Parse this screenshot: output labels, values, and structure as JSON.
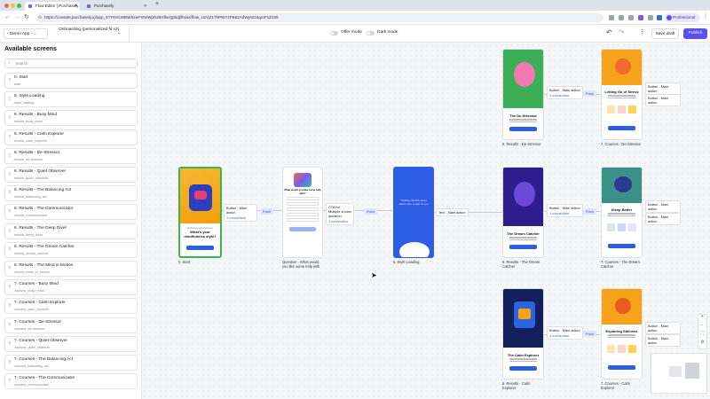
{
  "browser": {
    "tabs": [
      {
        "label": "Flow Editor | Purchasely"
      },
      {
        "label": "Purchasely"
      }
    ],
    "new_tab": "+",
    "url": "https://console.purchasely.io/app_5?YNrGWBWSzeFXNrWpD25rrfbeQpkdj/flows/flow_UoVZ1?hPWYzFB62AdWyW24qmF1Z225",
    "profile_label": "Professional"
  },
  "app": {
    "back_label": "Demo App - ...",
    "flow_name": "Onboarding (personalized fit v2)",
    "offer_mode_label": "Offer mode",
    "dark_mode_label": "Dark mode",
    "save_label": "Save draft",
    "publish_label": "Publish",
    "more_label": "⋮"
  },
  "sidebar": {
    "title": "Available screens",
    "search_placeholder": "Search",
    "items": [
      {
        "name": "0. Start",
        "slug": "start"
      },
      {
        "name": "5. Style Loading",
        "slug": "style_loading"
      },
      {
        "name": "6. Results - Busy Mind",
        "slug": "results_busy_mind"
      },
      {
        "name": "6. Results - Calm Explorer",
        "slug": "results_calm_explorer"
      },
      {
        "name": "6. Results - De-Stressor",
        "slug": "results_de-stressor"
      },
      {
        "name": "6. Results - Quiet Observer",
        "slug": "results_quiet_observer"
      },
      {
        "name": "6. Results - The Balancing Act",
        "slug": "results_balancing_act"
      },
      {
        "name": "6. Results - The Communicator",
        "slug": "results_communicator"
      },
      {
        "name": "6. Results - The Deep Diver",
        "slug": "results_deep_diver"
      },
      {
        "name": "6. Results - The Dream Catcher",
        "slug": "results_dream_catcher"
      },
      {
        "name": "6. Results - The Mind in Motion",
        "slug": "results_mind_in_motion"
      },
      {
        "name": "7. Courses - Busy Mind",
        "slug": "courses_busy_mind"
      },
      {
        "name": "7. Courses - Calm Explorer",
        "slug": "courses_calm_explorer"
      },
      {
        "name": "7. Courses - De-Stressor",
        "slug": "courses_de-stressor"
      },
      {
        "name": "7. Courses - Quiet Observer",
        "slug": "courses_quiet_observer"
      },
      {
        "name": "7. Courses - The Balancing Act",
        "slug": "courses_balancing_act"
      },
      {
        "name": "7. Courses - The Communicator",
        "slug": "courses_communicator"
      }
    ]
  },
  "canvas": {
    "screens": {
      "start": {
        "caption": "0. Start",
        "text_small": "Welcome to Headspace",
        "text_big": "What's your mindfulness style?",
        "button": "Continue"
      },
      "question": {
        "caption": "Question - What would you like some help with",
        "title": "What would you like some help with?"
      },
      "style_loading": {
        "caption": "5. Style Loading",
        "text": "Thinking carefully about what's next, a style for you"
      },
      "res_de_stressor": {
        "caption": "6. Results - De-Stressor",
        "title": "The De-Stressor"
      },
      "res_dream_catcher": {
        "caption": "6. Results - The Dream Catcher",
        "title": "The Dream Catcher"
      },
      "res_calm_explorer": {
        "caption": "6. Results - Calm Explorer",
        "title": "The Calm Explorer"
      },
      "crs_de_stressor": {
        "caption": "7. Courses - De-Stressor",
        "title": "Letting Go of Stress"
      },
      "crs_dream_catcher": {
        "caption": "7. Courses - The Dream Catcher",
        "title": "Sleep Better"
      },
      "crs_calm_explorer": {
        "caption": "7. Courses - Calm Explorer",
        "title": "Exploring Stillness"
      }
    },
    "nodes": {
      "start_action": {
        "label": "Button - Main action",
        "conn": "1 connection"
      },
      "question_action": {
        "label": "CTA for Multiple choice question",
        "conn": "1 connection"
      },
      "loading_action": {
        "label": "Text - Main action"
      },
      "res1_action": {
        "label": "Button - Main action",
        "conn": "1 connection"
      },
      "res2_action": {
        "label": "Button - Main action",
        "conn": "1 connection"
      },
      "res3_action": {
        "label": "Button - Main action",
        "conn": "1 connection"
      },
      "crs1_a": {
        "label": "Button - Main action"
      },
      "crs1_b": {
        "label": "Button - Main action"
      },
      "crs2_a": {
        "label": "Button - Main action"
      },
      "crs2_b": {
        "label": "Button - Main action"
      },
      "crs3_a": {
        "label": "Button - Main action"
      },
      "crs3_b": {
        "label": "Button - Main action"
      }
    },
    "push_label": "Push",
    "zoom_controls": [
      "+",
      "−",
      "⛶",
      "⚙"
    ]
  },
  "colors": {
    "accent": "#5b4ff0",
    "selected_border": "#3cb54a",
    "link": "#3a5bd9",
    "push_bg": "#dfe6fb"
  }
}
